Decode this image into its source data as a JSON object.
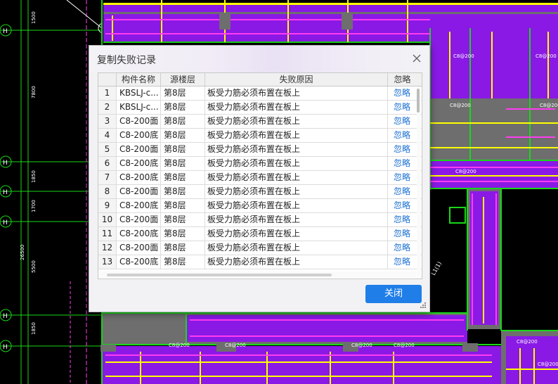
{
  "dialog": {
    "title": "复制失败记录",
    "close_icon": "close-icon",
    "close_button_label": "关闭"
  },
  "table": {
    "columns": [
      "构件名称",
      "源楼层",
      "失败原因",
      "忽略"
    ],
    "rows": [
      {
        "no": "1",
        "name": "KBSLJ-c...",
        "floor": "第8层",
        "reason": "板受力筋必须布置在板上",
        "action": "忽略"
      },
      {
        "no": "2",
        "name": "KBSLJ-c...",
        "floor": "第8层",
        "reason": "板受力筋必须布置在板上",
        "action": "忽略"
      },
      {
        "no": "3",
        "name": "C8-200面",
        "floor": "第8层",
        "reason": "板受力筋必须布置在板上",
        "action": "忽略"
      },
      {
        "no": "4",
        "name": "C8-200底",
        "floor": "第8层",
        "reason": "板受力筋必须布置在板上",
        "action": "忽略"
      },
      {
        "no": "5",
        "name": "C8-200面",
        "floor": "第8层",
        "reason": "板受力筋必须布置在板上",
        "action": "忽略"
      },
      {
        "no": "6",
        "name": "C8-200底",
        "floor": "第8层",
        "reason": "板受力筋必须布置在板上",
        "action": "忽略"
      },
      {
        "no": "7",
        "name": "C8-200底",
        "floor": "第8层",
        "reason": "板受力筋必须布置在板上",
        "action": "忽略"
      },
      {
        "no": "8",
        "name": "C8-200面",
        "floor": "第8层",
        "reason": "板受力筋必须布置在板上",
        "action": "忽略"
      },
      {
        "no": "9",
        "name": "C8-200底",
        "floor": "第8层",
        "reason": "板受力筋必须布置在板上",
        "action": "忽略"
      },
      {
        "no": "10",
        "name": "C8-200面",
        "floor": "第8层",
        "reason": "板受力筋必须布置在板上",
        "action": "忽略"
      },
      {
        "no": "11",
        "name": "C8-200底",
        "floor": "第8层",
        "reason": "板受力筋必须布置在板上",
        "action": "忽略"
      },
      {
        "no": "12",
        "name": "C8-200面",
        "floor": "第8层",
        "reason": "板受力筋必须布置在板上",
        "action": "忽略"
      },
      {
        "no": "13",
        "name": "C8-200底",
        "floor": "第8层",
        "reason": "板受力筋必须布置在板上",
        "action": "忽略"
      }
    ]
  },
  "cad": {
    "dimensions": [
      "1500",
      "7800",
      "1850",
      "1700",
      "26500",
      "5500",
      "1850"
    ],
    "axis_marks": [
      "H",
      "H",
      "H",
      "H",
      "H",
      "H"
    ],
    "slab_labels": [
      "C8@200",
      "C8@200",
      "C8@200",
      "C8@200",
      "C8@200",
      "C8@200",
      "C8@200",
      "C8@200",
      "C8@200",
      "C8@200",
      "C8@200"
    ],
    "beam_label": "L1(1)",
    "colors": {
      "slab": "#8a19e6",
      "wall": "#6e6e6e",
      "rebar_yellow": "#ffff00",
      "rebar_magenta": "#ff3cf0",
      "grid_green": "#18d818",
      "accent_button": "#1f7ee8"
    }
  }
}
